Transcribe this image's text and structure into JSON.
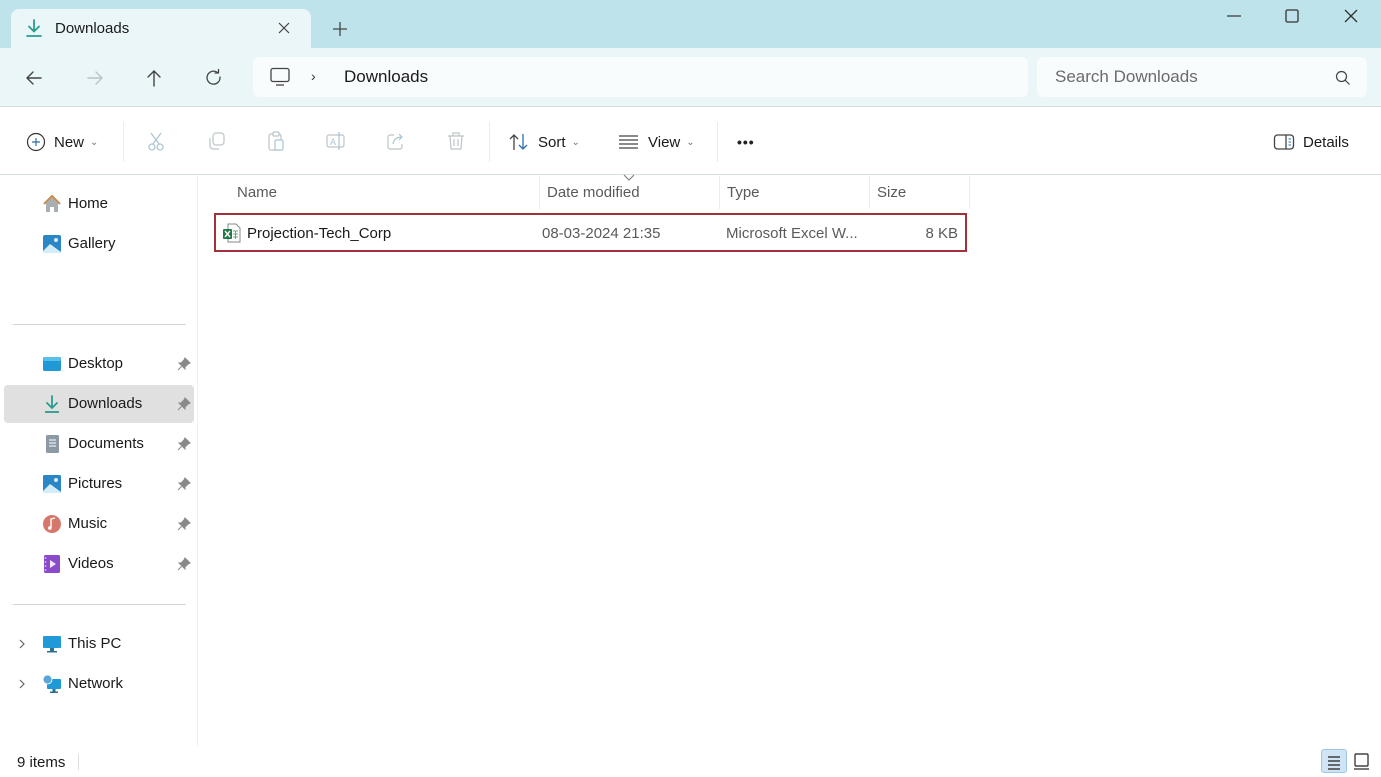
{
  "window": {
    "tab_title": "Downloads",
    "tab_icon": "download-icon",
    "controls": [
      "minimize-icon",
      "maximize-icon",
      "close-icon"
    ]
  },
  "navigation": {
    "back_enabled": true,
    "forward_enabled": false,
    "breadcrumb": {
      "root_icon": "this-pc-icon",
      "separator": "›",
      "current": "Downloads"
    },
    "search": {
      "placeholder": "Search Downloads",
      "value": ""
    }
  },
  "commandbar": {
    "new_label": "New",
    "sort_label": "Sort",
    "view_label": "View",
    "more_label": "•••",
    "details_label": "Details",
    "disabled_actions": [
      "cut",
      "copy",
      "paste",
      "rename",
      "share",
      "delete"
    ]
  },
  "sidebar": {
    "top_items": [
      {
        "label": "Home",
        "icon": "home-icon"
      },
      {
        "label": "Gallery",
        "icon": "gallery-icon"
      }
    ],
    "pinned_items": [
      {
        "label": "Desktop",
        "icon": "desktop-icon",
        "pinned": true
      },
      {
        "label": "Downloads",
        "icon": "download-icon",
        "pinned": true,
        "selected": true
      },
      {
        "label": "Documents",
        "icon": "documents-icon",
        "pinned": true
      },
      {
        "label": "Pictures",
        "icon": "pictures-icon",
        "pinned": true
      },
      {
        "label": "Music",
        "icon": "music-icon",
        "pinned": true
      },
      {
        "label": "Videos",
        "icon": "videos-icon",
        "pinned": true
      }
    ],
    "bottom_items": [
      {
        "label": "This PC",
        "icon": "this-pc-icon",
        "expandable": true
      },
      {
        "label": "Network",
        "icon": "network-icon",
        "expandable": true
      }
    ]
  },
  "filelist": {
    "columns": [
      "Name",
      "Date modified",
      "Type",
      "Size"
    ],
    "sorted_by": "Date modified",
    "rows": [
      {
        "name": "Projection-Tech_Corp",
        "date": "08-03-2024 21:35",
        "type": "Microsoft Excel W...",
        "size": "8 KB",
        "icon": "excel-file-icon",
        "highlighted": true
      }
    ]
  },
  "status": {
    "item_count": "9 items",
    "view_mode": "details"
  },
  "colors": {
    "titlebar": "#bfe3ea",
    "navrow": "#eaf6f8",
    "highlight_border": "#a2313a",
    "selected_nav": "#e0e0e0",
    "accent": "#2a9d8f"
  }
}
